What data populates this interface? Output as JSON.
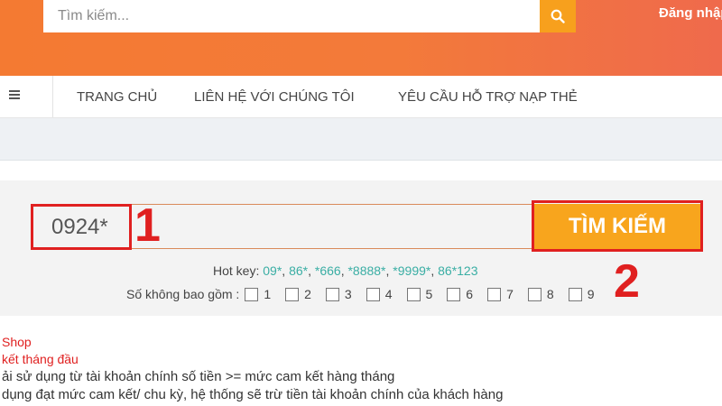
{
  "header": {
    "search_placeholder": "Tìm kiếm...",
    "login_label": "Đăng nhập"
  },
  "nav": {
    "items": [
      "TRANG CHỦ",
      "LIÊN HỆ VỚI CHÚNG TÔI",
      "YÊU CẦU HỖ TRỢ NẠP THẺ"
    ]
  },
  "search": {
    "input_value": "0924*",
    "button_label": "TÌM KIẾM",
    "annotation_1": "1",
    "annotation_2": "2"
  },
  "hotkeys": {
    "label": "Hot key:",
    "items": [
      "09*",
      "86*",
      "*666",
      "*8888*",
      "*9999*",
      "86*123"
    ]
  },
  "exclude": {
    "label": "Số không bao gồm :",
    "digits": [
      "1",
      "2",
      "3",
      "4",
      "5",
      "6",
      "7",
      "8",
      "9"
    ]
  },
  "info": {
    "line1": "Shop",
    "line2": "kết tháng đầu",
    "line3": "ải sử dụng từ tài khoản chính số tiền >= mức cam kết hàng tháng",
    "line4": "dụng đạt mức cam kết/ chu kỳ, hệ thống sẽ trừ tiền tài khoản chính của khách hàng"
  },
  "colors": {
    "header_gradient_start": "#f47a32",
    "header_gradient_end": "#ef6a4c",
    "button_orange": "#f8a51d",
    "annotation_red": "#e02020",
    "hotkey_teal": "#3aaea4"
  }
}
